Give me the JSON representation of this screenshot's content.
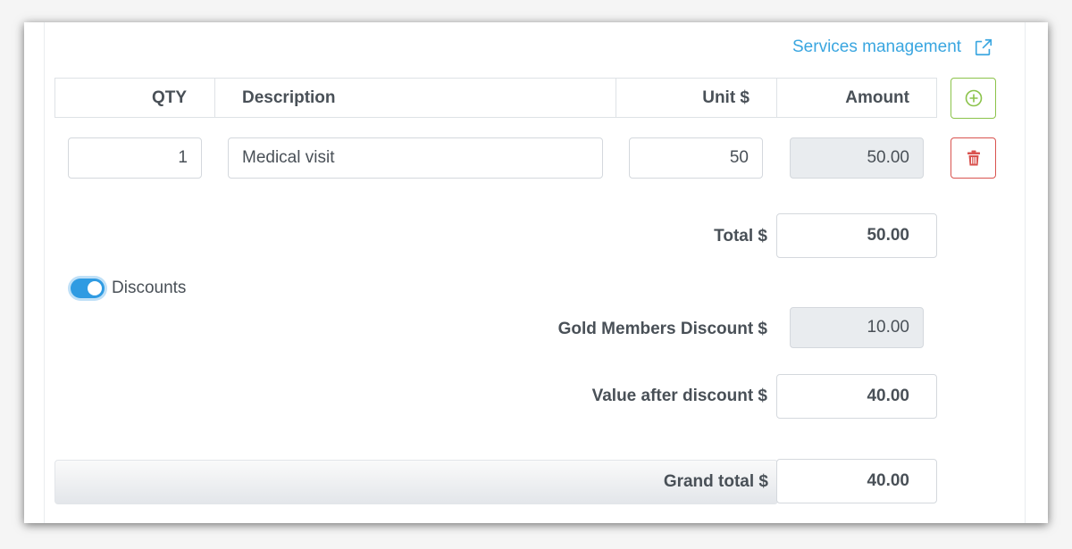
{
  "header": {
    "services_link": "Services management",
    "link_icon": "external-link-icon"
  },
  "table": {
    "columns": [
      "QTY",
      "Description",
      "Unit $",
      "Amount"
    ],
    "add_icon": "plus-circle-icon",
    "rows": [
      {
        "qty": "1",
        "description": "Medical visit",
        "unit": "50",
        "amount": "50.00",
        "delete_icon": "trash-icon"
      }
    ]
  },
  "totals": {
    "total_label": "Total $",
    "total_value": "50.00",
    "discounts_toggle_label": "Discounts",
    "discounts_enabled": true,
    "discount_label": "Gold Members Discount $",
    "discount_value": "10.00",
    "after_discount_label": "Value after discount $",
    "after_discount_value": "40.00",
    "grand_total_label": "Grand total $",
    "grand_total_value": "40.00"
  },
  "colors": {
    "link": "#3aa6e0",
    "add": "#8bc34a",
    "delete": "#d9534f",
    "toggle": "#2f9be2"
  }
}
